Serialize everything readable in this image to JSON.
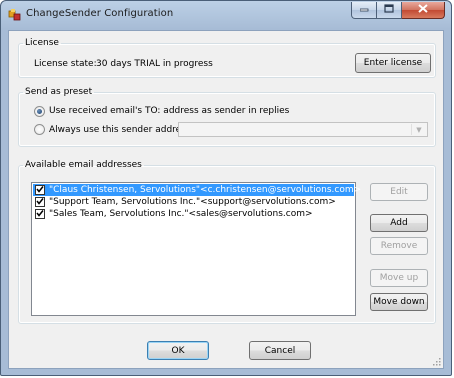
{
  "window": {
    "title": "ChangeSender Configuration"
  },
  "license": {
    "group_title": "License",
    "state_label": "License state:",
    "state_value": "30 days TRIAL in progress",
    "enter_button": "Enter license"
  },
  "preset": {
    "group_title": "Send as preset",
    "option_received": "Use received email's TO: address as sender in replies",
    "option_always": "Always use this sender address:",
    "selected_option": "received",
    "address_value": ""
  },
  "addresses": {
    "group_title": "Available email addresses",
    "items": [
      {
        "text": "\"Claus Christensen, Servolutions\"<c.christensen@servolutions.com>",
        "checked": true,
        "selected": true
      },
      {
        "text": "\"Support Team, Servolutions Inc.\"<support@servolutions.com>",
        "checked": true,
        "selected": false
      },
      {
        "text": "\"Sales Team, Servolutions Inc.\"<sales@servolutions.com>",
        "checked": true,
        "selected": false
      }
    ],
    "buttons": {
      "edit": "Edit",
      "add": "Add",
      "remove": "Remove",
      "move_up": "Move up",
      "move_down": "Move down"
    }
  },
  "footer": {
    "ok": "OK",
    "cancel": "Cancel"
  },
  "colors": {
    "selection": "#3399ff",
    "title_bar": "#bcd0e6",
    "close_button": "#c24a33"
  }
}
